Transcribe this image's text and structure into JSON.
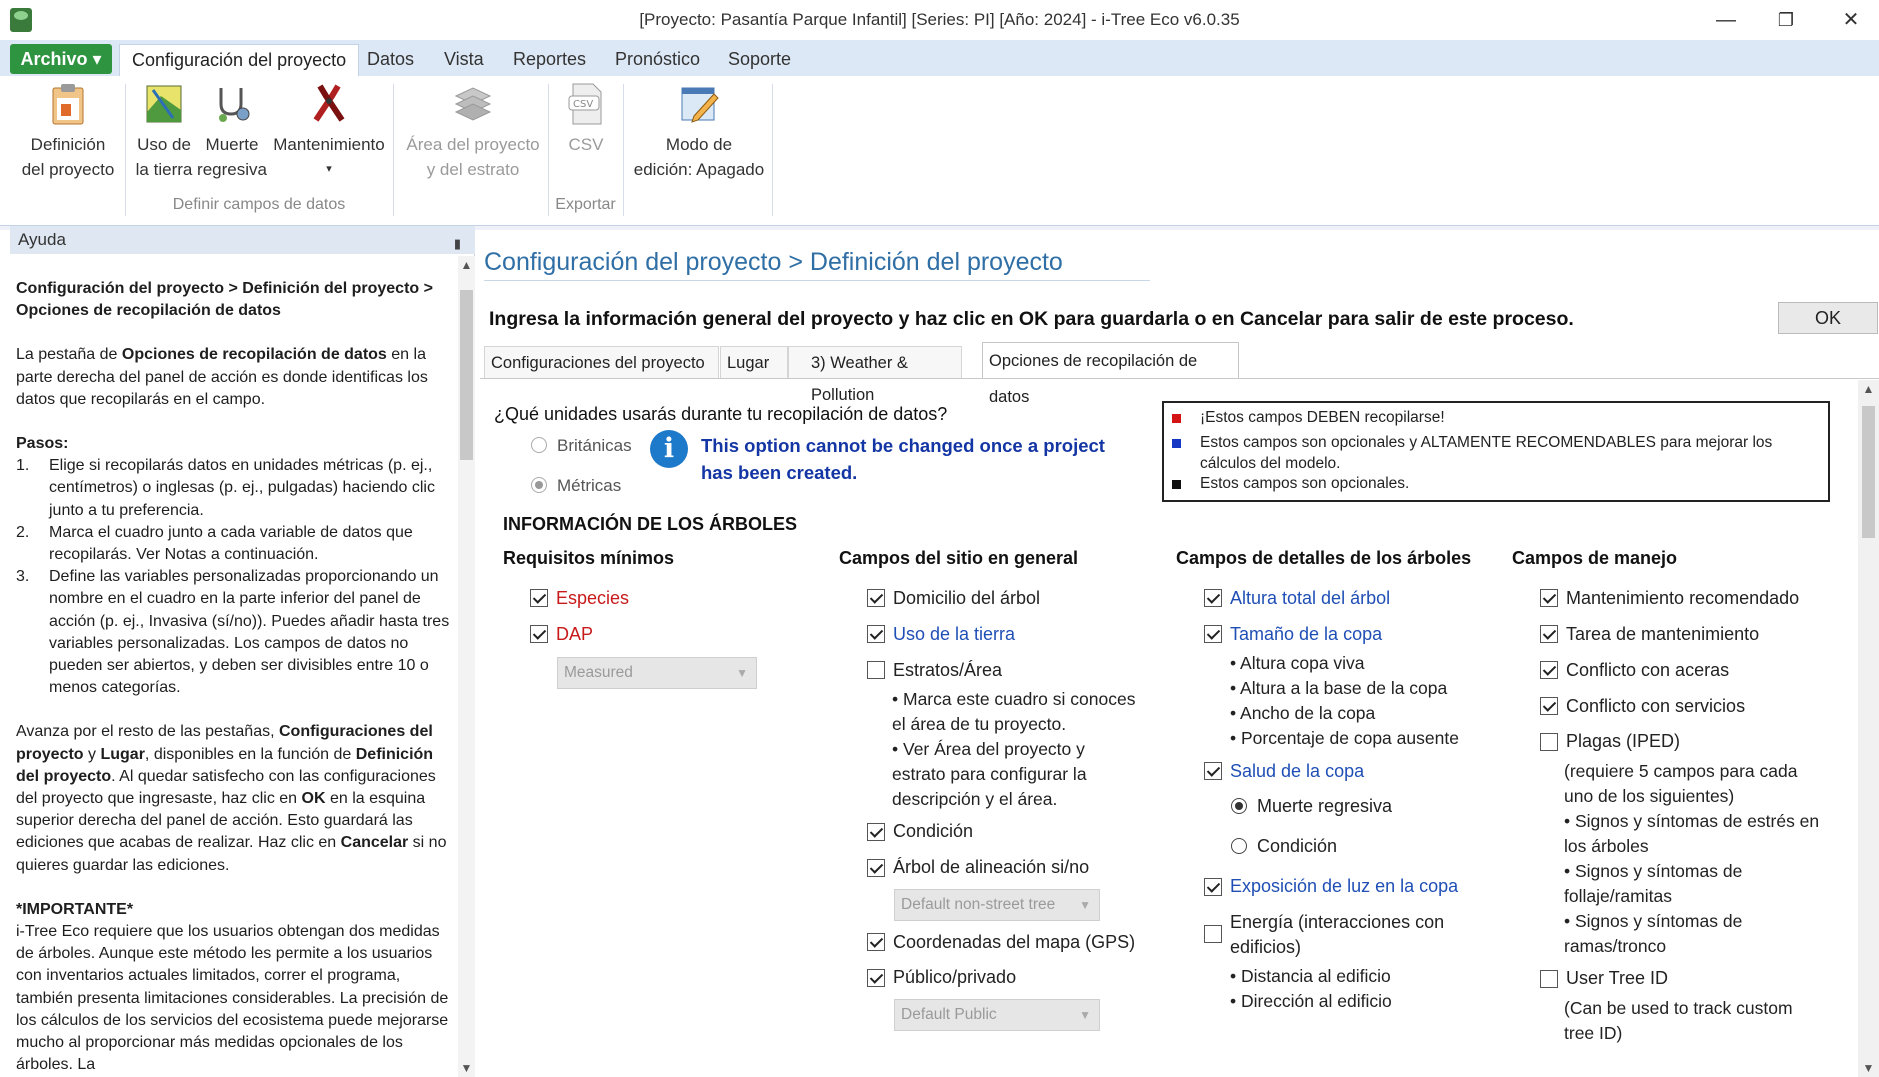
{
  "window": {
    "title": "[Proyecto: Pasantía Parque Infantil] [Series: PI] [Año: 2024] - i-Tree Eco v6.0.35",
    "minimize": "—",
    "restore": "❐",
    "close": "✕"
  },
  "ribbon_tabs": {
    "archivo": "Archivo ▾",
    "items": [
      "Configuración del proyecto",
      "Datos",
      "Vista",
      "Reportes",
      "Pronóstico",
      "Soporte"
    ]
  },
  "ribbon": {
    "definicion": [
      "Definición",
      "del proyecto"
    ],
    "uso": [
      "Uso de",
      "la tierra"
    ],
    "muerte": [
      "Muerte",
      "regresiva"
    ],
    "mantenimiento": [
      "Mantenimiento",
      "▾"
    ],
    "area": [
      "Área del proyecto",
      "y del estrato"
    ],
    "csv": "CSV",
    "modo": [
      "Modo de",
      "edición: Apagado"
    ],
    "group_definir": "Definir campos de datos",
    "group_exportar": "Exportar"
  },
  "help": {
    "header": "Ayuda",
    "pin": "📌",
    "breadcrumb": "Configuración del proyecto > Definición del proyecto > Opciones de recopilación de datos",
    "intro_pre": "La pestaña de ",
    "intro_bold": "Opciones de recopilación de datos",
    "intro_post": " en la parte derecha del panel de acción es donde identificas los datos que recopilarás en el campo.",
    "pasos": "Pasos:",
    "steps": [
      "Elige si recopilarás datos en unidades métricas (p. ej., centímetros) o inglesas (p. ej., pulgadas) haciendo clic junto a tu preferencia.",
      "Marca el cuadro junto a cada variable de datos que recopilarás. Ver Notas a continuación.",
      "Define las variables personalizadas proporcionando un nombre en el cuadro en la parte inferior del panel de acción (p. ej., Invasiva (sí/no)). Puedes añadir hasta tres variables personalizadas. Los campos de datos no pueden ser abiertos, y deben ser divisibles entre 10 o menos categorías."
    ],
    "para": [
      {
        "t": "Avanza por el resto de las pestañas, ",
        "b": false
      },
      {
        "t": "Configuraciones del proyecto",
        "b": true
      },
      {
        "t": " y ",
        "b": false
      },
      {
        "t": "Lugar",
        "b": true
      },
      {
        "t": ", disponibles en la función de ",
        "b": false
      },
      {
        "t": "Definición del proyecto",
        "b": true
      },
      {
        "t": ". Al quedar satisfecho con las configuraciones del proyecto que ingresaste, haz clic en ",
        "b": false
      },
      {
        "t": "OK",
        "b": true
      },
      {
        "t": " en la esquina superior derecha del panel de acción. Esto guardará las ediciones que acabas de realizar. Haz clic en ",
        "b": false
      },
      {
        "t": "Cancelar",
        "b": true
      },
      {
        "t": " si no quieres guardar las ediciones.",
        "b": false
      }
    ],
    "importante": "*IMPORTANTE*",
    "importante_text": "i-Tree Eco requiere que los usuarios obtengan dos medidas de árboles. Aunque este método les permite a los usuarios con inventarios actuales limitados, correr el programa, también presenta limitaciones considerables. La precisión de los cálculos de los servicios del ecosistema puede mejorarse mucho al proporcionar más medidas opcionales de los árboles. La"
  },
  "main": {
    "bc_part1": "Configuración del proyecto",
    "bc_sep": " > ",
    "bc_part2": "Definición del proyecto",
    "instruction": "Ingresa la información general del proyecto y haz clic en OK para guardarla o en Cancelar para salir de este proceso.",
    "ok": "OK",
    "tabs": [
      "Configuraciones del proyecto",
      "Lugar",
      "3) Weather & Pollution",
      "Opciones de recopilación de datos"
    ],
    "units_question": "¿Qué unidades usarás durante tu recopilación de datos?",
    "britanicas": "Británicas",
    "metricas": "Métricas",
    "info_icon": "i",
    "info_text": "This option cannot be changed once a project has been created.",
    "legend": {
      "red": "¡Estos campos DEBEN recopilarse!",
      "blue": "Estos campos son opcionales y ALTAMENTE RECOMENDABLES para mejorar los cálculos del modelo.",
      "black": "Estos campos son opcionales.",
      "colors": {
        "red": "#d41414",
        "blue": "#1537c4",
        "black": "#111111"
      }
    },
    "info_arboles": "INFORMACIÓN DE LOS ÁRBOLES",
    "col1": {
      "header": "Requisitos mínimos",
      "especies": "Especies",
      "dap": "DAP",
      "measured": "Measured"
    },
    "col2": {
      "header": "Campos del sitio en general",
      "domicilio": "Domicilio del árbol",
      "uso": "Uso de la tierra",
      "estratos": "Estratos/Área",
      "b1": "•  Marca este cuadro si conoces",
      "b1b": "el área de tu proyecto.",
      "b2": "•  Ver Área del proyecto y",
      "b2b": "estrato para configurar la",
      "b2c": "descripción y el área.",
      "condicion": "Condición",
      "alineacion": "Árbol de alineación si/no",
      "default_street": "Default non-street tree",
      "coordenadas": "Coordenadas del mapa (GPS)",
      "publico": "Público/privado",
      "default_public": "Default Public"
    },
    "col3": {
      "header": "Campos de detalles de los árboles",
      "altura": "Altura total del árbol",
      "tamano": "Tamaño de la copa",
      "s1": "•  Altura copa viva",
      "s2": "•  Altura a la base de la copa",
      "s3": "•  Ancho de la copa",
      "s4": "•  Porcentaje de copa ausente",
      "salud": "Salud de la copa",
      "muerte": "Muerte regresiva",
      "condicion": "Condición",
      "exposicion": "Exposición de luz en la copa",
      "energia": "Energía (interacciones con",
      "energia2": "edificios)",
      "d1": "•  Distancia al edificio",
      "d2": "•  Dirección al edificio"
    },
    "col4": {
      "header": "Campos de manejo",
      "m1": "Mantenimiento recomendado",
      "m2": "Tarea de mantenimiento",
      "m3": "Conflicto con aceras",
      "m4": "Conflicto con servicios",
      "plagas": "Plagas (IPED)",
      "p1": "(requiere 5 campos para cada",
      "p2": "uno de los siguientes)",
      "p3": "•  Signos y síntomas de estrés en",
      "p4": "los árboles",
      "p5": "•  Signos y síntomas de",
      "p6": "follaje/ramitas",
      "p7": "•  Signos y síntomas de",
      "p8": "ramas/tronco",
      "user": "User Tree ID",
      "u1": "(Can be used to track custom",
      "u2": "tree ID)"
    }
  }
}
